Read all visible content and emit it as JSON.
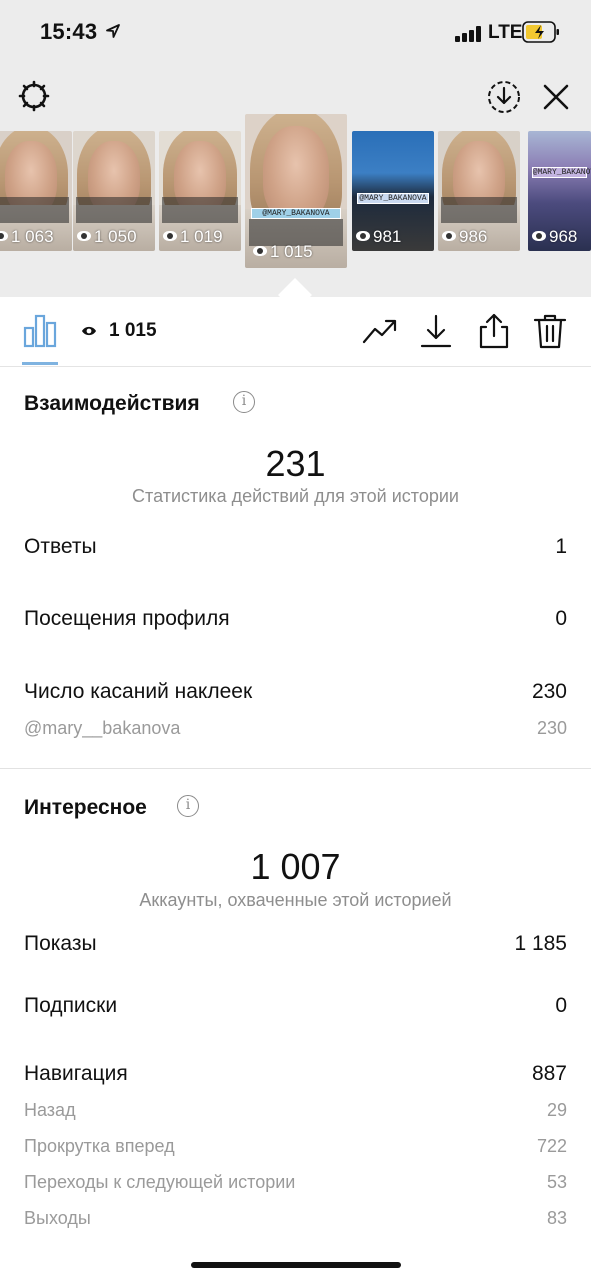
{
  "status_bar": {
    "time": "15:43",
    "network": "LTE"
  },
  "stories": [
    {
      "views": "1 063",
      "sticker": ""
    },
    {
      "views": "1 050",
      "sticker": ""
    },
    {
      "views": "1 019",
      "sticker": ""
    },
    {
      "views": "1 015",
      "sticker": "@MARY_BAKANOVA"
    },
    {
      "views": "981",
      "sticker": "@MARY_BAKANOVA"
    },
    {
      "views": "986",
      "sticker": ""
    },
    {
      "views": "968",
      "sticker": "@MARY_BAKANOVA"
    }
  ],
  "toolbar": {
    "views": "1 015"
  },
  "interactions": {
    "title": "Взаимодействия",
    "total": "231",
    "total_caption": "Статистика действий для этой истории",
    "rows": [
      {
        "label": "Ответы",
        "value": "1"
      },
      {
        "label": "Посещения профиля",
        "value": "0"
      },
      {
        "label": "Число касаний наклеек",
        "value": "230"
      }
    ],
    "sub_rows": [
      {
        "label": "@mary__bakanova",
        "value": "230"
      }
    ]
  },
  "discovery": {
    "title": "Интересное",
    "total": "1 007",
    "total_caption": "Аккаунты, охваченные этой историей",
    "rows": [
      {
        "label": "Показы",
        "value": "1 185"
      },
      {
        "label": "Подписки",
        "value": "0"
      },
      {
        "label": "Навигация",
        "value": "887"
      }
    ],
    "sub_rows": [
      {
        "label": "Назад",
        "value": "29"
      },
      {
        "label": "Прокрутка вперед",
        "value": "722"
      },
      {
        "label": "Переходы к следующей истории",
        "value": "53"
      },
      {
        "label": "Выходы",
        "value": "83"
      }
    ]
  },
  "colors": {
    "accent": "#7fb3e0",
    "muted": "#9a9a9a",
    "text": "#111111"
  }
}
